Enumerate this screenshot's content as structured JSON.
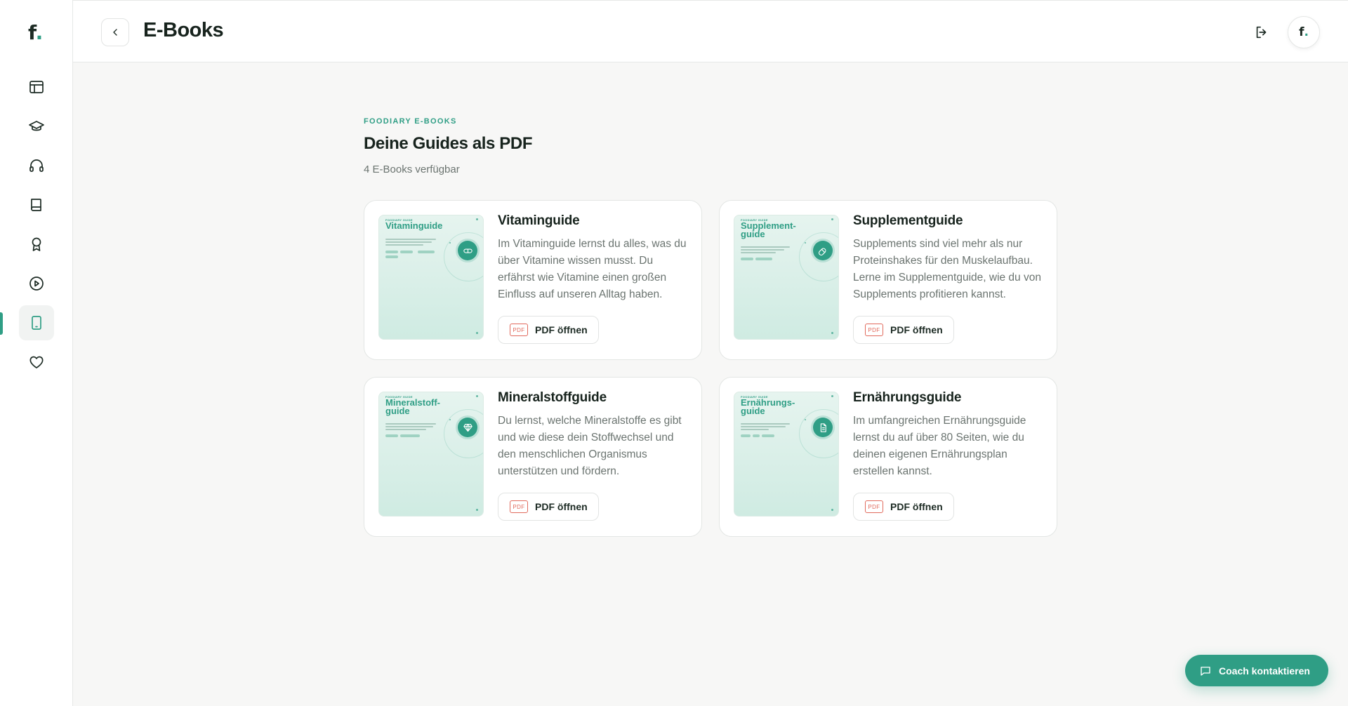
{
  "sidebar": {
    "logo": {
      "text": "f",
      "dot": "."
    },
    "items": [
      {
        "name": "dashboard",
        "icon": "layout-icon",
        "active": false
      },
      {
        "name": "academy",
        "icon": "graduation-cap-icon",
        "active": false
      },
      {
        "name": "podcast",
        "icon": "headphones-icon",
        "active": false
      },
      {
        "name": "recipes",
        "icon": "book-icon",
        "active": false
      },
      {
        "name": "achievements",
        "icon": "award-icon",
        "active": false
      },
      {
        "name": "videos",
        "icon": "play-circle-icon",
        "active": false
      },
      {
        "name": "ebooks",
        "icon": "tablet-icon",
        "active": true
      },
      {
        "name": "favorites",
        "icon": "heart-icon",
        "active": false
      }
    ]
  },
  "header": {
    "title": "E-Books",
    "avatar": {
      "text": "f",
      "dot": "."
    }
  },
  "main": {
    "eyebrow": "FOODIARY E-BOOKS",
    "title": "Deine Guides als PDF",
    "subtitle": "4 E-Books verfügbar",
    "ebooks": [
      {
        "title": "Vitaminguide",
        "cover_eyebrow": "FOODIARY GUIDE",
        "cover_title": "Vitaminguide",
        "cover_icon": "pill-icon",
        "description": "Im Vitaminguide lernst du alles, was du über Vitamine wissen musst. Du erfährst wie Vitamine einen großen Einfluss auf unseren Alltag haben.",
        "pdf_badge": "PDF",
        "button_label": "PDF öffnen"
      },
      {
        "title": "Supplementguide",
        "cover_eyebrow": "FOODIARY GUIDE",
        "cover_title": "Supplement-guide",
        "cover_icon": "capsule-icon",
        "description": "Supplements sind viel mehr als nur Proteinshakes für den Muskelaufbau. Lerne im Supplementguide, wie du von Supplements profitieren kannst.",
        "pdf_badge": "PDF",
        "button_label": "PDF öffnen"
      },
      {
        "title": "Mineralstoffguide",
        "cover_eyebrow": "FOODIARY GUIDE",
        "cover_title": "Mineralstoff-guide",
        "cover_icon": "gem-icon",
        "description": "Du lernst, welche Mineralstoffe es gibt und wie diese dein Stoffwechsel und den menschlichen Organismus unterstützen und fördern.",
        "pdf_badge": "PDF",
        "button_label": "PDF öffnen"
      },
      {
        "title": "Ernährungsguide",
        "cover_eyebrow": "FOODIARY GUIDE",
        "cover_title": "Ernährungs-guide",
        "cover_icon": "document-icon",
        "description": "Im umfangreichen Ernährungsguide lernst du auf über 80 Seiten, wie du deinen eigenen Ernährungsplan erstellen kannst.",
        "pdf_badge": "PDF",
        "button_label": "PDF öffnen"
      }
    ]
  },
  "coach_button": {
    "label": "Coach kontaktieren"
  },
  "colors": {
    "accent": "#2f9e85",
    "pdf_red": "#e16a5c",
    "text": "#17231d",
    "muted": "#6b7470"
  }
}
